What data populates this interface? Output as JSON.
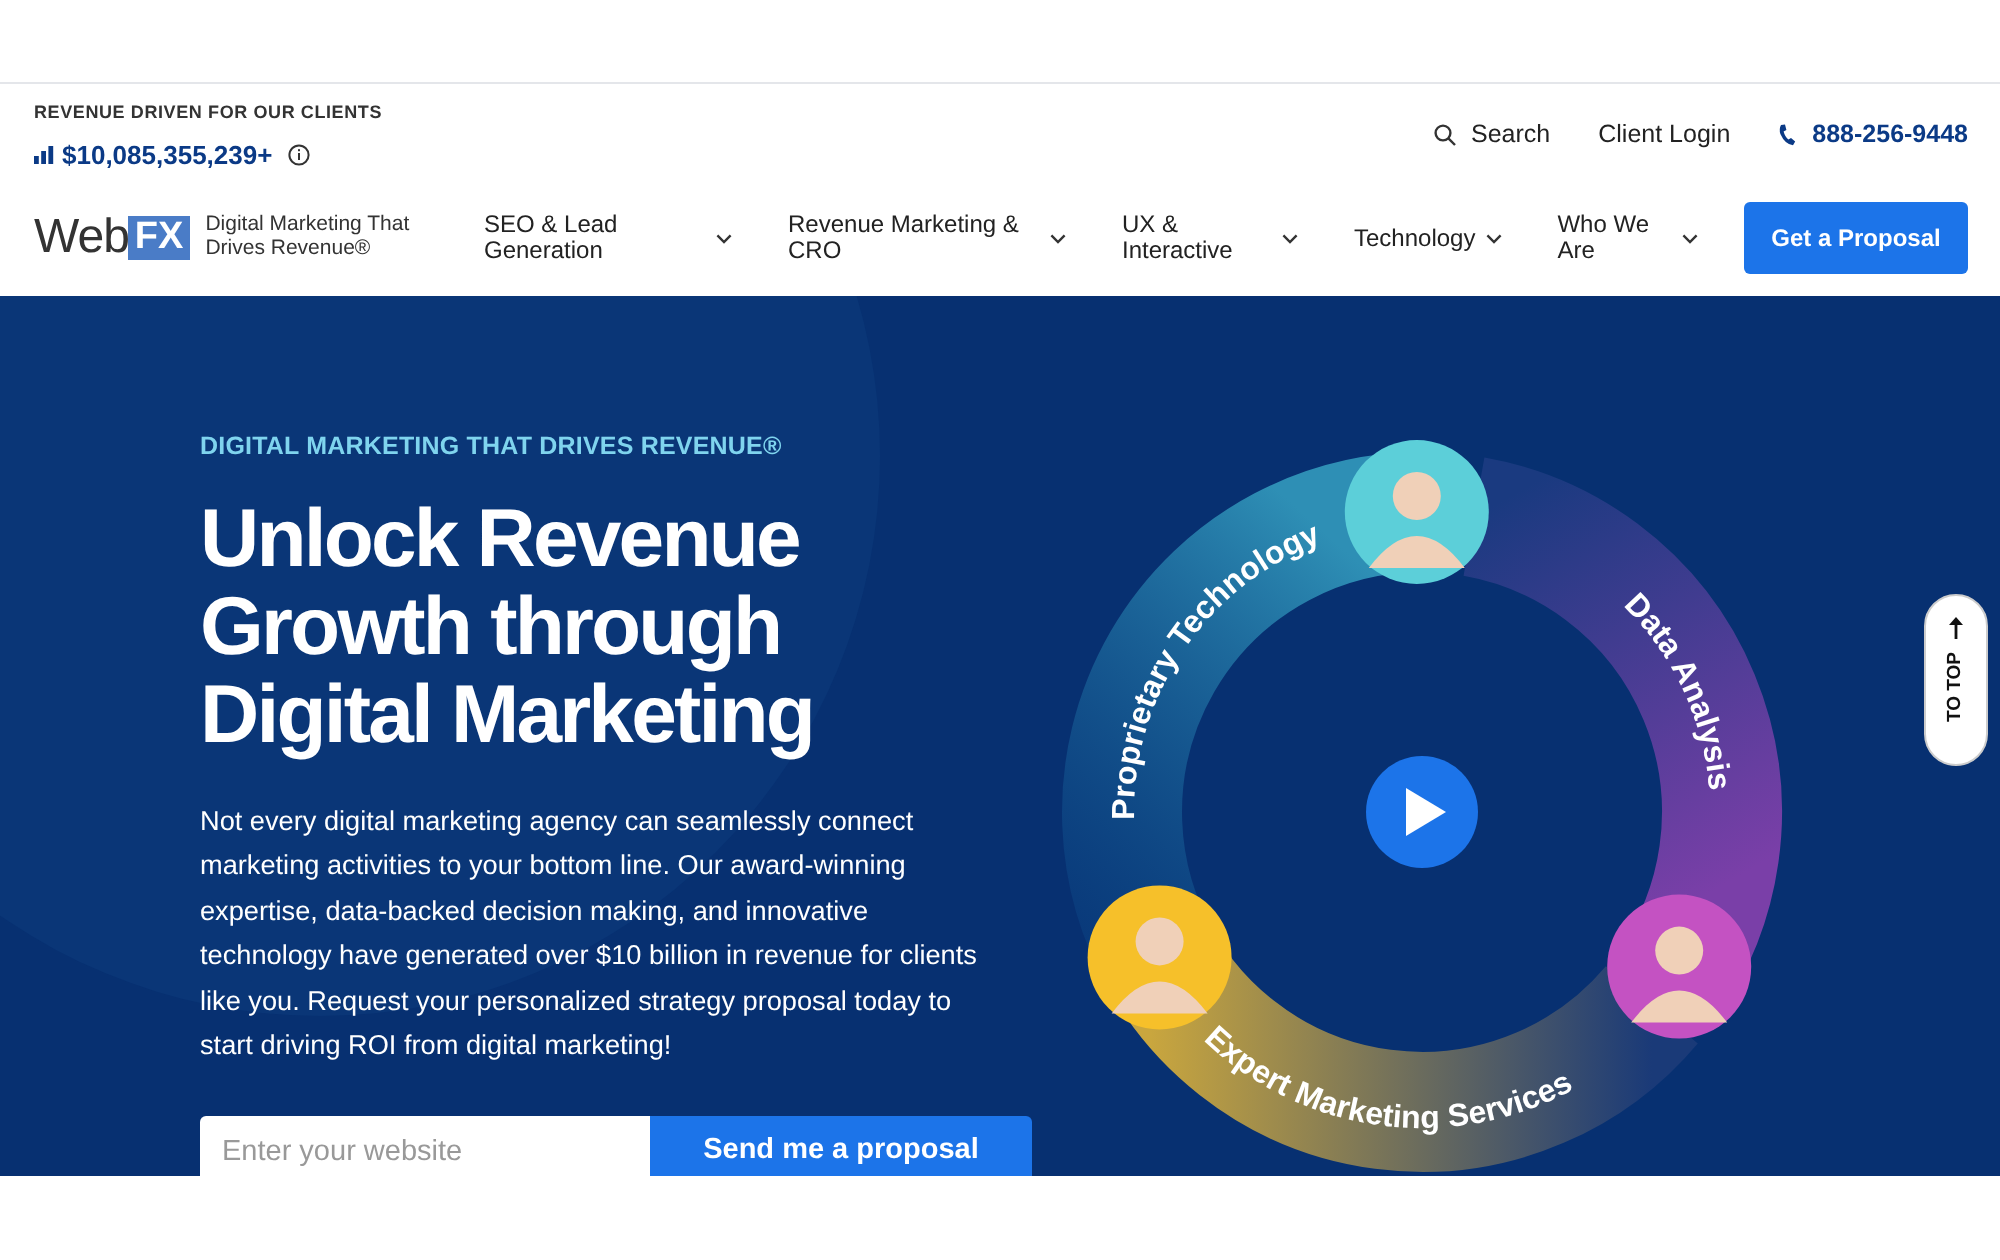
{
  "topbar": {
    "revenue_label": "REVENUE DRIVEN FOR OUR CLIENTS",
    "revenue_amount": "$10,085,355,239+",
    "search": "Search",
    "client_login": "Client Login",
    "phone": "888-256-9448"
  },
  "logo": {
    "word": "Web",
    "mark": "FX",
    "tagline": "Digital Marketing That Drives Revenue®"
  },
  "nav": [
    {
      "label": "SEO & Lead Generation"
    },
    {
      "label": "Revenue Marketing & CRO"
    },
    {
      "label": "UX & Interactive"
    },
    {
      "label": "Technology"
    },
    {
      "label": "Who We Are"
    }
  ],
  "cta": "Get a Proposal",
  "hero": {
    "eyebrow": "DIGITAL MARKETING THAT DRIVES REVENUE®",
    "title": [
      "Unlock Revenue",
      "Growth through",
      "Digital Marketing"
    ],
    "body": "Not every digital marketing agency can seamlessly connect marketing activities to your bottom line. Our award-winning expertise, data-backed decision making, and innovative technology have generated over $10 billion in revenue for clients like you. Request your personalized strategy proposal today to start driving ROI from digital marketing!",
    "input_placeholder": "Enter your website",
    "submit": "Send me a proposal"
  },
  "ring": [
    {
      "label": "Proprietary Technology",
      "color": "#5ccfd9"
    },
    {
      "label": "Data Analysis",
      "color": "#c452c2"
    },
    {
      "label": "Expert Marketing Services",
      "color": "#f6c02a"
    }
  ],
  "to_top": "TO TOP"
}
